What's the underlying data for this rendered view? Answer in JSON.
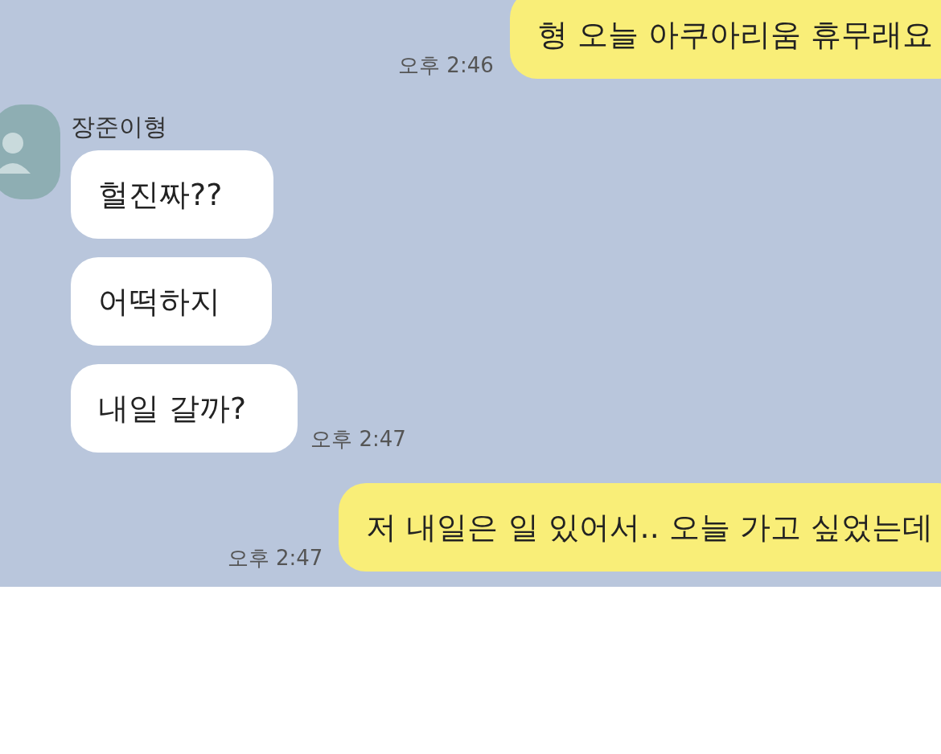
{
  "chat": {
    "messages": [
      {
        "kind": "outgoing",
        "text": "형 오늘 아쿠아리움 휴무래요",
        "time": "오후 2:46"
      },
      {
        "kind": "incoming",
        "sender": "장준이형",
        "bubbles": [
          "헐진짜??",
          "어떡하지",
          "내일 갈까?"
        ],
        "time": "오후 2:47"
      },
      {
        "kind": "outgoing",
        "text": "저 내일은 일 있어서.. 오늘 가고 싶었는데",
        "time": "오후 2:47"
      }
    ]
  }
}
